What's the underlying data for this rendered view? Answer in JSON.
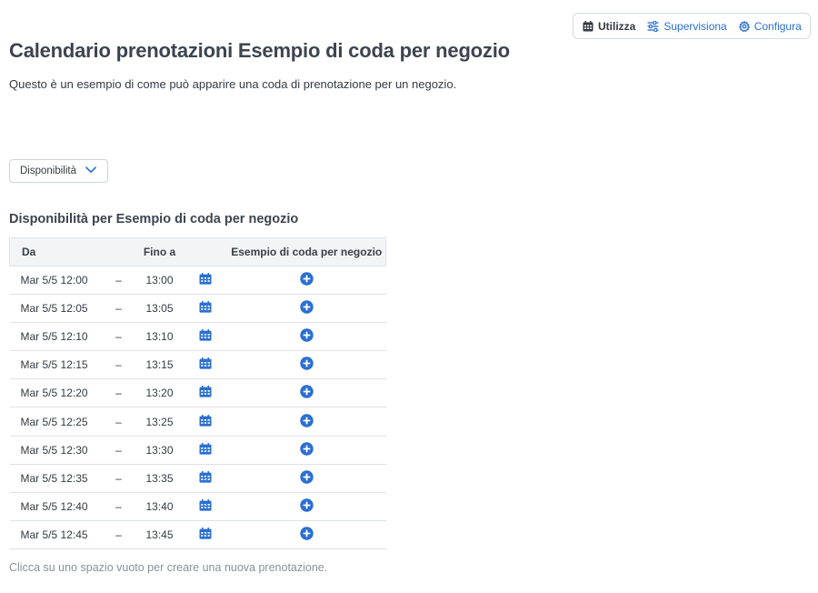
{
  "nav": {
    "items": [
      {
        "label": "Utilizza",
        "icon": "calendar-icon",
        "active": true
      },
      {
        "label": "Supervisiona",
        "icon": "sliders-icon",
        "active": false
      },
      {
        "label": "Configura",
        "icon": "gear-icon",
        "active": false
      }
    ]
  },
  "page": {
    "title": "Calendario prenotazioni Esempio di coda per negozio",
    "description": "Questo è un esempio di come può apparire una coda di prenotazione per un negozio."
  },
  "filter": {
    "label": "Disponibilità",
    "icon": "chevron-down-icon"
  },
  "availability": {
    "title": "Disponibilità per Esempio di coda per negozio",
    "columns": {
      "from": "Da",
      "to": "Fino a",
      "queue": "Esempio di coda per negozio"
    },
    "separator": "–",
    "rows": [
      {
        "from": "Mar 5/5 12:00",
        "to": "13:00"
      },
      {
        "from": "Mar 5/5 12:05",
        "to": "13:05"
      },
      {
        "from": "Mar 5/5 12:10",
        "to": "13:10"
      },
      {
        "from": "Mar 5/5 12:15",
        "to": "13:15"
      },
      {
        "from": "Mar 5/5 12:20",
        "to": "13:20"
      },
      {
        "from": "Mar 5/5 12:25",
        "to": "13:25"
      },
      {
        "from": "Mar 5/5 12:30",
        "to": "13:30"
      },
      {
        "from": "Mar 5/5 12:35",
        "to": "13:35"
      },
      {
        "from": "Mar 5/5 12:40",
        "to": "13:40"
      },
      {
        "from": "Mar 5/5 12:45",
        "to": "13:45"
      }
    ],
    "hint": "Clicca su uno spazio vuoto per creare una nuova prenotazione."
  },
  "colors": {
    "accent": "#2a6fd1",
    "text": "#333a44",
    "border": "#dfe2e6",
    "header_bg": "#f2f4f7"
  }
}
